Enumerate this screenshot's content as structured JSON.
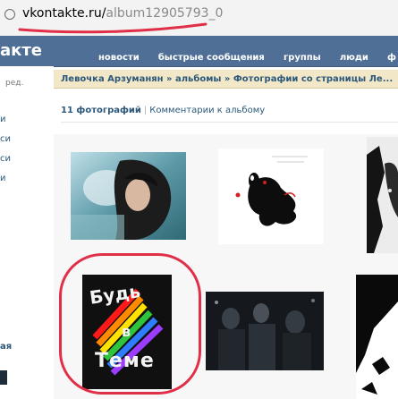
{
  "browser": {
    "address_host": "vkontakte.ru/",
    "address_path": "album12905793_0"
  },
  "navbar": {
    "logo": "акте",
    "links": [
      "новости",
      "быстрые сообщения",
      "группы",
      "люди",
      "ф"
    ]
  },
  "sidebar": {
    "edit_label": "ред.",
    "items": [
      "и",
      "си",
      "си",
      "и"
    ],
    "bottom_label": "ая"
  },
  "breadcrumb": "Левочка Арзуманян » альбомы » Фотографии со страницы Ле...",
  "album": {
    "photo_count": "11 фотографий",
    "separator": "|",
    "comments_link": "Комментарии к альбому"
  },
  "poster": {
    "line1": "Будь",
    "line2": "в",
    "line3": "Теме"
  },
  "colors": {
    "navbar": "#4f6f96",
    "breadcrumb_bg": "#f2e8c8",
    "link": "#2b587a",
    "annotation_red": "#e03048"
  }
}
